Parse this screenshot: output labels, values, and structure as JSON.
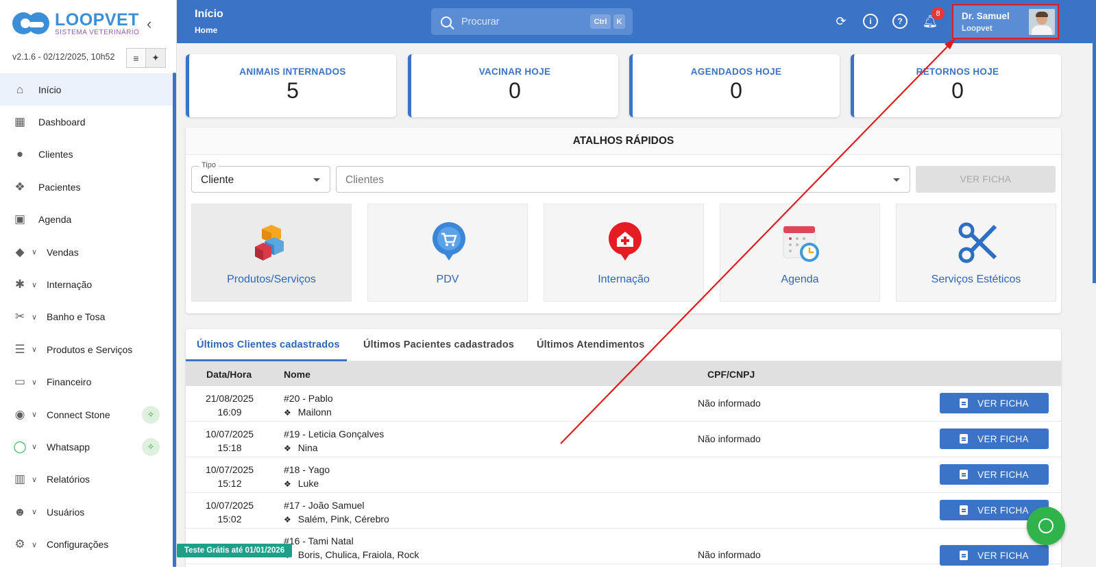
{
  "sidebar": {
    "logo_title": "LOOPVET",
    "logo_subtitle": "SISTEMA VETERINÁRIO",
    "version": "v2.1.6 - 02/12/2025, 10h52",
    "items": [
      {
        "label": "Início",
        "icon": "home-icon"
      },
      {
        "label": "Dashboard",
        "icon": "dashboard-icon"
      },
      {
        "label": "Clientes",
        "icon": "person-icon"
      },
      {
        "label": "Pacientes",
        "icon": "paw-icon"
      },
      {
        "label": "Agenda",
        "icon": "calendar-icon"
      },
      {
        "label": "Vendas",
        "icon": "tag-icon"
      },
      {
        "label": "Internação",
        "icon": "asterisk-icon"
      },
      {
        "label": "Banho e Tosa",
        "icon": "scissors-icon"
      },
      {
        "label": "Produtos e Serviços",
        "icon": "list-icon"
      },
      {
        "label": "Financeiro",
        "icon": "money-icon"
      },
      {
        "label": "Connect Stone",
        "icon": "stone-icon"
      },
      {
        "label": "Whatsapp",
        "icon": "whatsapp-icon"
      },
      {
        "label": "Relatórios",
        "icon": "report-icon"
      },
      {
        "label": "Usuários",
        "icon": "users-icon"
      },
      {
        "label": "Configurações",
        "icon": "gear-icon"
      }
    ],
    "trial_banner": "Teste Grátis até 01/01/2026"
  },
  "header": {
    "title": "Início",
    "breadcrumb": "Home",
    "search_placeholder": "Procurar",
    "kbd_ctrl": "Ctrl",
    "kbd_k": "K",
    "notifications_count": "8",
    "user_name": "Dr. Samuel",
    "user_org": "Loopvet"
  },
  "stats": [
    {
      "label": "ANIMAIS INTERNADOS",
      "value": "5"
    },
    {
      "label": "VACINAR HOJE",
      "value": "0"
    },
    {
      "label": "AGENDADOS HOJE",
      "value": "0"
    },
    {
      "label": "RETORNOS HOJE",
      "value": "0"
    }
  ],
  "shortcuts": {
    "title": "ATALHOS RÁPIDOS",
    "tipo_label": "Tipo",
    "tipo_value": "Cliente",
    "clientes_placeholder": "Clientes",
    "ver_ficha": "VER FICHA",
    "tiles": [
      {
        "label": "Produtos/Serviços",
        "icon": "cubes-icon"
      },
      {
        "label": "PDV",
        "icon": "cart-pin-icon"
      },
      {
        "label": "Internação",
        "icon": "hospital-pin-icon"
      },
      {
        "label": "Agenda",
        "icon": "calendar-clock-icon"
      },
      {
        "label": "Serviços Estéticos",
        "icon": "scissors-icon"
      }
    ]
  },
  "tabs": [
    {
      "label": "Últimos Clientes cadastrados"
    },
    {
      "label": "Últimos Pacientes cadastrados"
    },
    {
      "label": "Últimos Atendimentos"
    }
  ],
  "table": {
    "headers": {
      "date": "Data/Hora",
      "name": "Nome",
      "cpf": "CPF/CNPJ"
    },
    "button_label": "VER FICHA",
    "rows": [
      {
        "date": "21/08/2025",
        "time": "16:09",
        "name": "#20 - Pablo",
        "pets": "Mailonn",
        "cpf": "Não informado"
      },
      {
        "date": "10/07/2025",
        "time": "15:18",
        "name": "#19 - Leticia Gonçalves",
        "pets": "Nina",
        "cpf": "Não informado"
      },
      {
        "date": "10/07/2025",
        "time": "15:12",
        "name": "#18 - Yago",
        "pets": "Luke",
        "cpf": ""
      },
      {
        "date": "10/07/2025",
        "time": "15:02",
        "name": "#17 - João Samuel",
        "pets": "Salém,  Pink,  Cérebro",
        "cpf": ""
      },
      {
        "date": "",
        "time": "",
        "name": "#16 - Tami Natal",
        "pets": "Boris,  Chulica,  Fraiola,  Rock",
        "cpf": "Não informado"
      }
    ]
  },
  "colors": {
    "primary": "#3b73c7",
    "annotation": "#e01b1b",
    "whatsapp": "#2fb34a"
  }
}
